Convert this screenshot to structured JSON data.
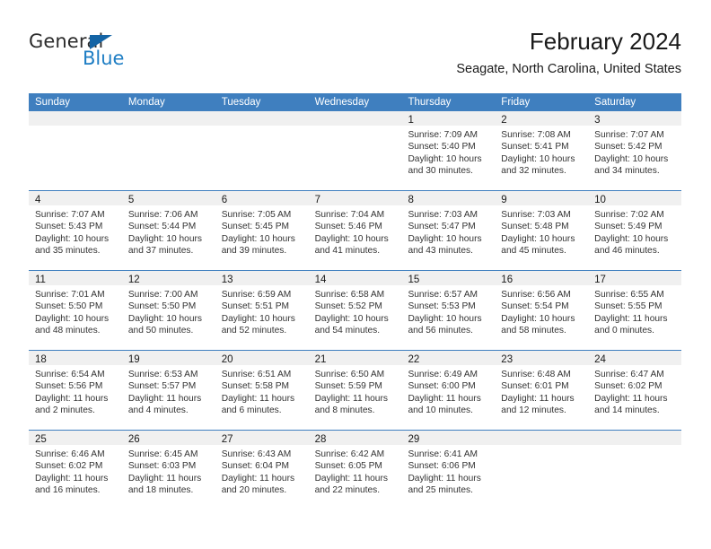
{
  "brand": {
    "name_top": "General",
    "name_bottom": "Blue",
    "triangle_color": "#1464a5",
    "blue_color": "#1f7ec4"
  },
  "header": {
    "title": "February 2024",
    "subtitle": "Seagate, North Carolina, United States"
  },
  "theme": {
    "header_blue": "#3f7fbf",
    "daynum_band": "#f0f0f0",
    "text": "#333333"
  },
  "weekdays": [
    "Sunday",
    "Monday",
    "Tuesday",
    "Wednesday",
    "Thursday",
    "Friday",
    "Saturday"
  ],
  "weeks": [
    [
      {
        "day": "",
        "lines": []
      },
      {
        "day": "",
        "lines": []
      },
      {
        "day": "",
        "lines": []
      },
      {
        "day": "",
        "lines": []
      },
      {
        "day": "1",
        "lines": [
          "Sunrise: 7:09 AM",
          "Sunset: 5:40 PM",
          "Daylight: 10 hours",
          "and 30 minutes."
        ]
      },
      {
        "day": "2",
        "lines": [
          "Sunrise: 7:08 AM",
          "Sunset: 5:41 PM",
          "Daylight: 10 hours",
          "and 32 minutes."
        ]
      },
      {
        "day": "3",
        "lines": [
          "Sunrise: 7:07 AM",
          "Sunset: 5:42 PM",
          "Daylight: 10 hours",
          "and 34 minutes."
        ]
      }
    ],
    [
      {
        "day": "4",
        "lines": [
          "Sunrise: 7:07 AM",
          "Sunset: 5:43 PM",
          "Daylight: 10 hours",
          "and 35 minutes."
        ]
      },
      {
        "day": "5",
        "lines": [
          "Sunrise: 7:06 AM",
          "Sunset: 5:44 PM",
          "Daylight: 10 hours",
          "and 37 minutes."
        ]
      },
      {
        "day": "6",
        "lines": [
          "Sunrise: 7:05 AM",
          "Sunset: 5:45 PM",
          "Daylight: 10 hours",
          "and 39 minutes."
        ]
      },
      {
        "day": "7",
        "lines": [
          "Sunrise: 7:04 AM",
          "Sunset: 5:46 PM",
          "Daylight: 10 hours",
          "and 41 minutes."
        ]
      },
      {
        "day": "8",
        "lines": [
          "Sunrise: 7:03 AM",
          "Sunset: 5:47 PM",
          "Daylight: 10 hours",
          "and 43 minutes."
        ]
      },
      {
        "day": "9",
        "lines": [
          "Sunrise: 7:03 AM",
          "Sunset: 5:48 PM",
          "Daylight: 10 hours",
          "and 45 minutes."
        ]
      },
      {
        "day": "10",
        "lines": [
          "Sunrise: 7:02 AM",
          "Sunset: 5:49 PM",
          "Daylight: 10 hours",
          "and 46 minutes."
        ]
      }
    ],
    [
      {
        "day": "11",
        "lines": [
          "Sunrise: 7:01 AM",
          "Sunset: 5:50 PM",
          "Daylight: 10 hours",
          "and 48 minutes."
        ]
      },
      {
        "day": "12",
        "lines": [
          "Sunrise: 7:00 AM",
          "Sunset: 5:50 PM",
          "Daylight: 10 hours",
          "and 50 minutes."
        ]
      },
      {
        "day": "13",
        "lines": [
          "Sunrise: 6:59 AM",
          "Sunset: 5:51 PM",
          "Daylight: 10 hours",
          "and 52 minutes."
        ]
      },
      {
        "day": "14",
        "lines": [
          "Sunrise: 6:58 AM",
          "Sunset: 5:52 PM",
          "Daylight: 10 hours",
          "and 54 minutes."
        ]
      },
      {
        "day": "15",
        "lines": [
          "Sunrise: 6:57 AM",
          "Sunset: 5:53 PM",
          "Daylight: 10 hours",
          "and 56 minutes."
        ]
      },
      {
        "day": "16",
        "lines": [
          "Sunrise: 6:56 AM",
          "Sunset: 5:54 PM",
          "Daylight: 10 hours",
          "and 58 minutes."
        ]
      },
      {
        "day": "17",
        "lines": [
          "Sunrise: 6:55 AM",
          "Sunset: 5:55 PM",
          "Daylight: 11 hours",
          "and 0 minutes."
        ]
      }
    ],
    [
      {
        "day": "18",
        "lines": [
          "Sunrise: 6:54 AM",
          "Sunset: 5:56 PM",
          "Daylight: 11 hours",
          "and 2 minutes."
        ]
      },
      {
        "day": "19",
        "lines": [
          "Sunrise: 6:53 AM",
          "Sunset: 5:57 PM",
          "Daylight: 11 hours",
          "and 4 minutes."
        ]
      },
      {
        "day": "20",
        "lines": [
          "Sunrise: 6:51 AM",
          "Sunset: 5:58 PM",
          "Daylight: 11 hours",
          "and 6 minutes."
        ]
      },
      {
        "day": "21",
        "lines": [
          "Sunrise: 6:50 AM",
          "Sunset: 5:59 PM",
          "Daylight: 11 hours",
          "and 8 minutes."
        ]
      },
      {
        "day": "22",
        "lines": [
          "Sunrise: 6:49 AM",
          "Sunset: 6:00 PM",
          "Daylight: 11 hours",
          "and 10 minutes."
        ]
      },
      {
        "day": "23",
        "lines": [
          "Sunrise: 6:48 AM",
          "Sunset: 6:01 PM",
          "Daylight: 11 hours",
          "and 12 minutes."
        ]
      },
      {
        "day": "24",
        "lines": [
          "Sunrise: 6:47 AM",
          "Sunset: 6:02 PM",
          "Daylight: 11 hours",
          "and 14 minutes."
        ]
      }
    ],
    [
      {
        "day": "25",
        "lines": [
          "Sunrise: 6:46 AM",
          "Sunset: 6:02 PM",
          "Daylight: 11 hours",
          "and 16 minutes."
        ]
      },
      {
        "day": "26",
        "lines": [
          "Sunrise: 6:45 AM",
          "Sunset: 6:03 PM",
          "Daylight: 11 hours",
          "and 18 minutes."
        ]
      },
      {
        "day": "27",
        "lines": [
          "Sunrise: 6:43 AM",
          "Sunset: 6:04 PM",
          "Daylight: 11 hours",
          "and 20 minutes."
        ]
      },
      {
        "day": "28",
        "lines": [
          "Sunrise: 6:42 AM",
          "Sunset: 6:05 PM",
          "Daylight: 11 hours",
          "and 22 minutes."
        ]
      },
      {
        "day": "29",
        "lines": [
          "Sunrise: 6:41 AM",
          "Sunset: 6:06 PM",
          "Daylight: 11 hours",
          "and 25 minutes."
        ]
      },
      {
        "day": "",
        "lines": []
      },
      {
        "day": "",
        "lines": []
      }
    ]
  ]
}
